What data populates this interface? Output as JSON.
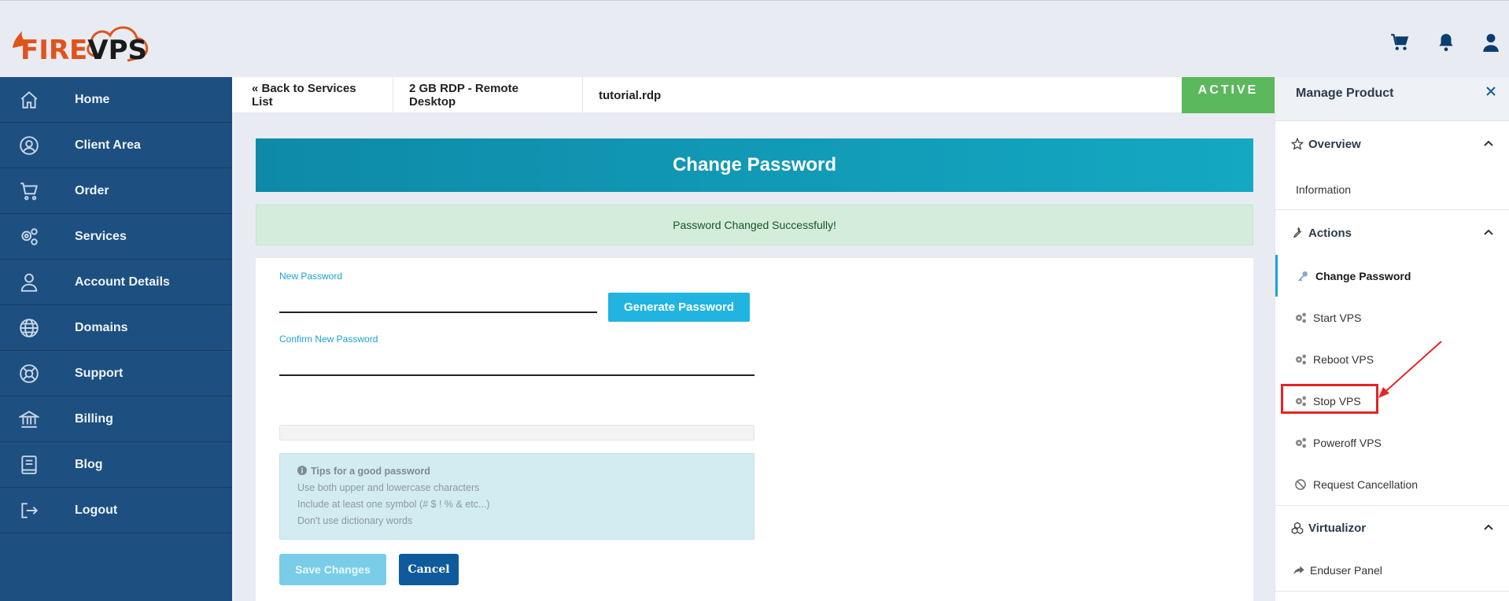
{
  "brand": {
    "logo_part1": "FIRE",
    "logo_part2": "VPS",
    "logo_accent": "#e0541c"
  },
  "header": {
    "icons": [
      "cart-icon",
      "bell-icon",
      "user-icon"
    ]
  },
  "sidebar": {
    "items": [
      {
        "label": "Home",
        "icon": "home-icon"
      },
      {
        "label": "Client Area",
        "icon": "user-circle-icon"
      },
      {
        "label": "Order",
        "icon": "cart-icon"
      },
      {
        "label": "Services",
        "icon": "gears-icon"
      },
      {
        "label": "Account Details",
        "icon": "user-icon"
      },
      {
        "label": "Domains",
        "icon": "globe-icon"
      },
      {
        "label": "Support",
        "icon": "lifebuoy-icon"
      },
      {
        "label": "Billing",
        "icon": "bank-icon"
      },
      {
        "label": "Blog",
        "icon": "book-icon"
      },
      {
        "label": "Logout",
        "icon": "logout-icon"
      }
    ]
  },
  "breadcrumbs": {
    "back": "« Back to Services List",
    "product": "2 GB RDP - Remote Desktop",
    "domain": "tutorial.rdp",
    "status": "ACTIVE",
    "status_color": "#5cb85c"
  },
  "main": {
    "title": "Change Password",
    "success_message": "Password Changed Successfully!",
    "new_password_label": "New Password",
    "new_password_value": "",
    "confirm_password_label": "Confirm New Password",
    "confirm_password_value": "",
    "generate_button": "Generate Password",
    "tips": {
      "title": "Tips for a good password",
      "lines": [
        "Use both upper and lowercase characters",
        "Include at least one symbol (# $ ! % & etc...)",
        "Don't use dictionary words"
      ]
    },
    "save_button": "Save Changes",
    "cancel_button": "Cancel"
  },
  "manage_product": {
    "title": "Manage Product",
    "close_icon": "close-icon",
    "sections": [
      {
        "title": "Overview",
        "icon": "star-icon",
        "items": [
          {
            "label": "Information",
            "icon": ""
          }
        ]
      },
      {
        "title": "Actions",
        "icon": "wrench-icon",
        "items": [
          {
            "label": "Change Password",
            "icon": "key-icon",
            "active": true
          },
          {
            "label": "Start VPS",
            "icon": "gears-icon"
          },
          {
            "label": "Reboot VPS",
            "icon": "gears-icon"
          },
          {
            "label": "Stop VPS",
            "icon": "gears-icon"
          },
          {
            "label": "Poweroff VPS",
            "icon": "gears-icon"
          },
          {
            "label": "Request Cancellation",
            "icon": "ban-icon"
          }
        ]
      },
      {
        "title": "Virtualizor",
        "icon": "cubes-icon",
        "items": [
          {
            "label": "Enduser Panel",
            "icon": "share-icon"
          }
        ]
      }
    ]
  },
  "annotation": {
    "highlight_color": "#e52424"
  }
}
